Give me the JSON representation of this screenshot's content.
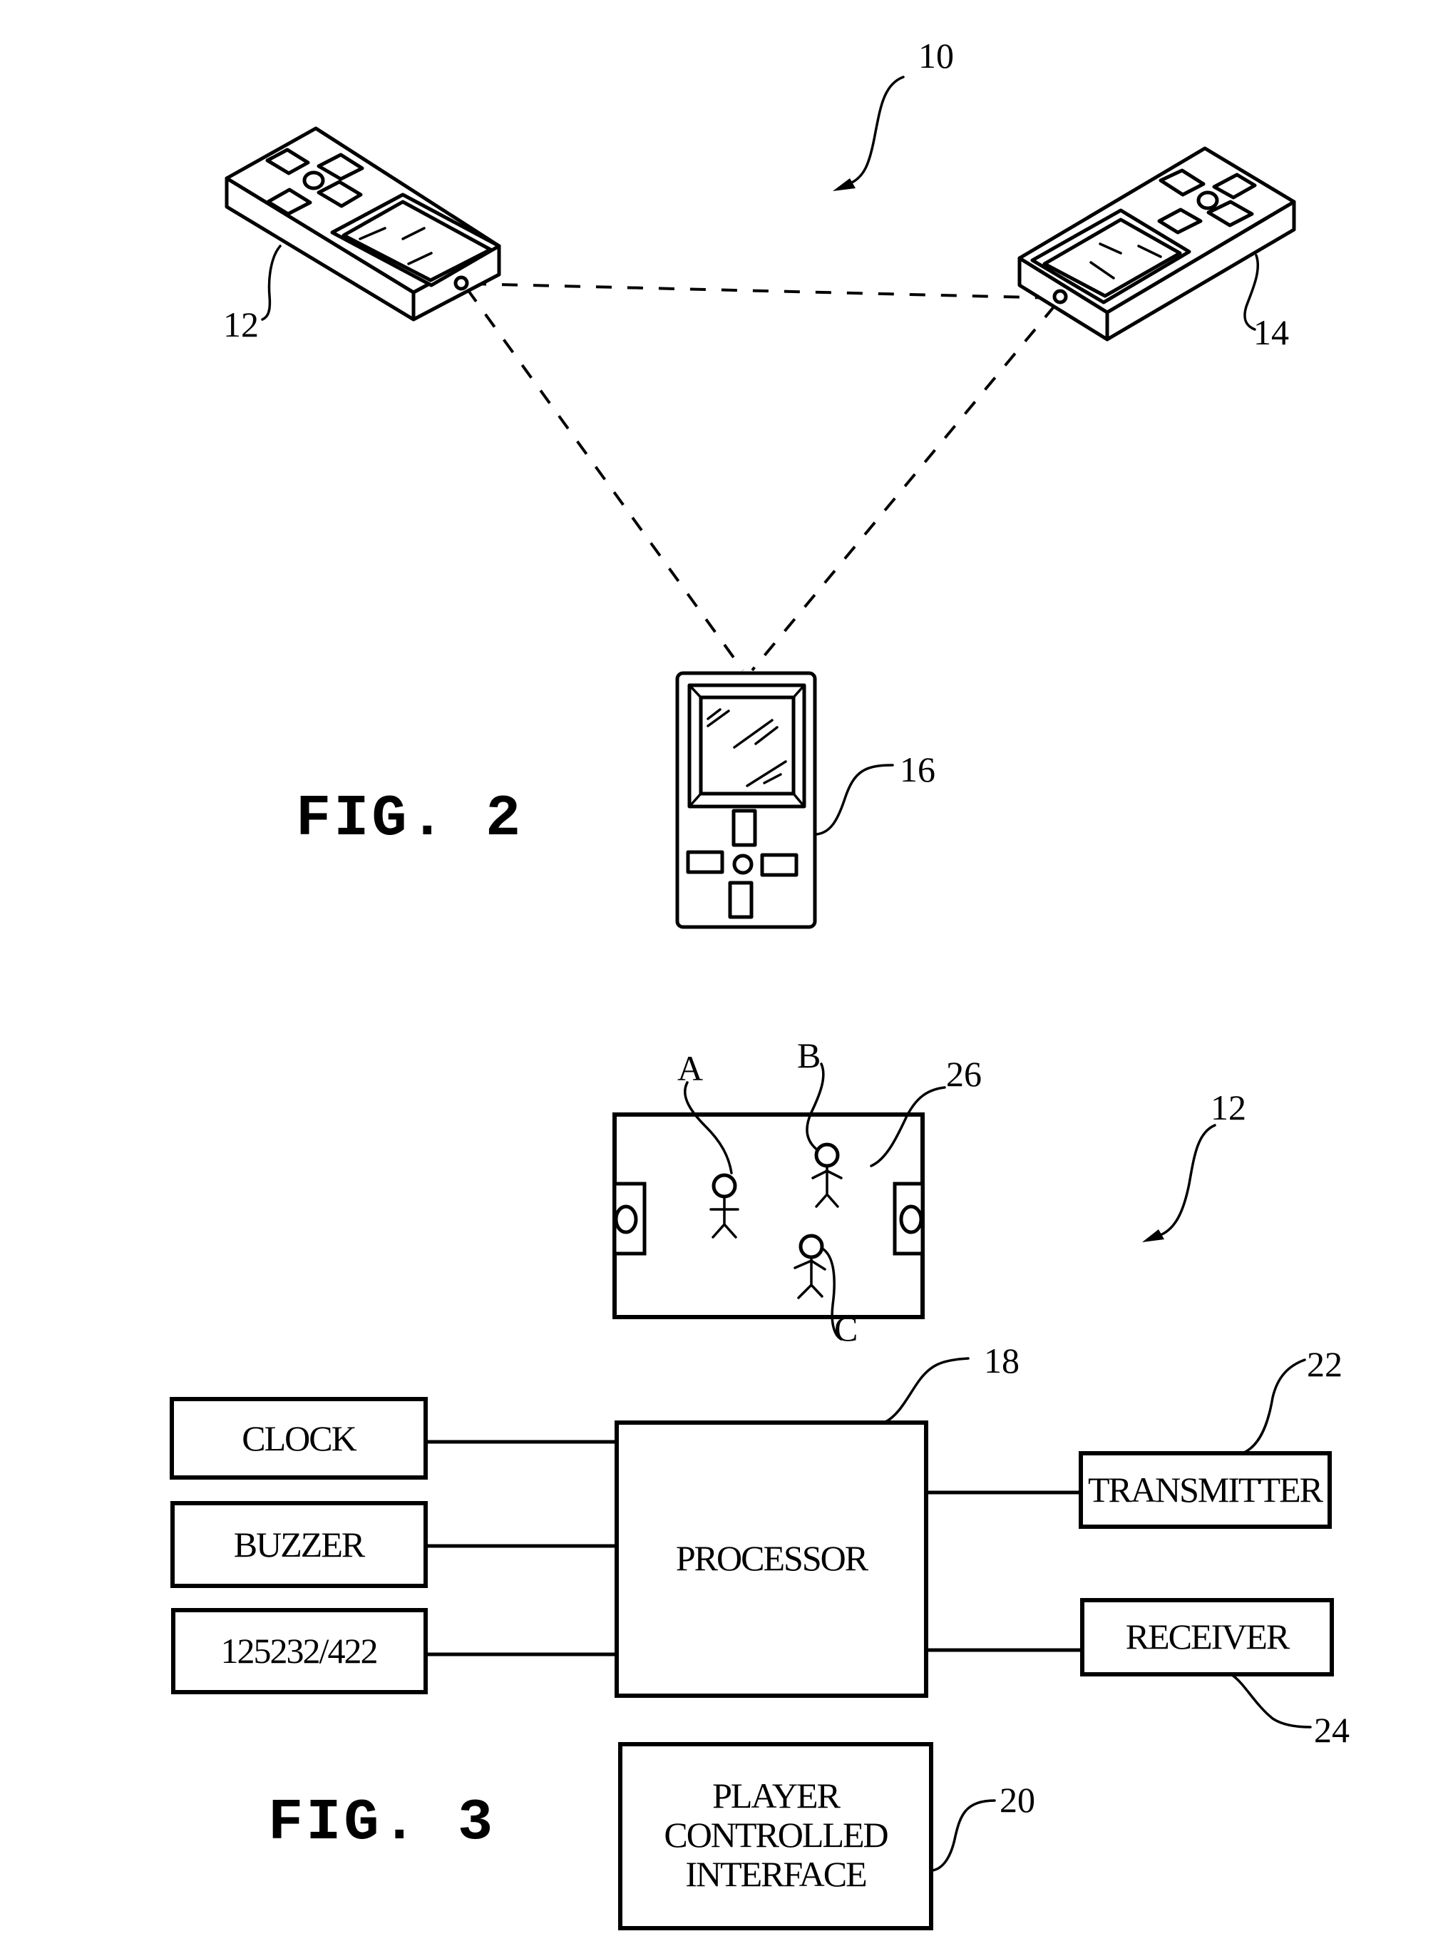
{
  "figure2": {
    "caption": "FIG. 2",
    "system_ref": "10",
    "devices": [
      {
        "ref": "12",
        "type": "handheld game device",
        "orientation": "isometric-left"
      },
      {
        "ref": "14",
        "type": "handheld game device",
        "orientation": "isometric-right"
      },
      {
        "ref": "16",
        "type": "handheld game device",
        "orientation": "front"
      }
    ],
    "links": [
      {
        "from": "12",
        "to": "14",
        "style": "dashed"
      },
      {
        "from": "12",
        "to": "16",
        "style": "dashed"
      },
      {
        "from": "14",
        "to": "16",
        "style": "dashed"
      }
    ]
  },
  "figure3": {
    "caption": "FIG. 3",
    "device_ref": "12",
    "display": {
      "ref": "26",
      "players": [
        {
          "label": "A"
        },
        {
          "label": "B"
        },
        {
          "label": "C"
        }
      ]
    },
    "blocks": {
      "clock": {
        "label": "CLOCK"
      },
      "buzzer": {
        "label": "BUZZER"
      },
      "serial": {
        "label": "125232/422"
      },
      "processor": {
        "label": "PROCESSOR",
        "ref": "18"
      },
      "transmitter": {
        "label": "TRANSMITTER",
        "ref": "22"
      },
      "receiver": {
        "label": "RECEIVER",
        "ref": "24"
      },
      "interface": {
        "lines": [
          "PLAYER",
          "CONTROLLED",
          "INTERFACE"
        ],
        "ref": "20"
      }
    }
  }
}
